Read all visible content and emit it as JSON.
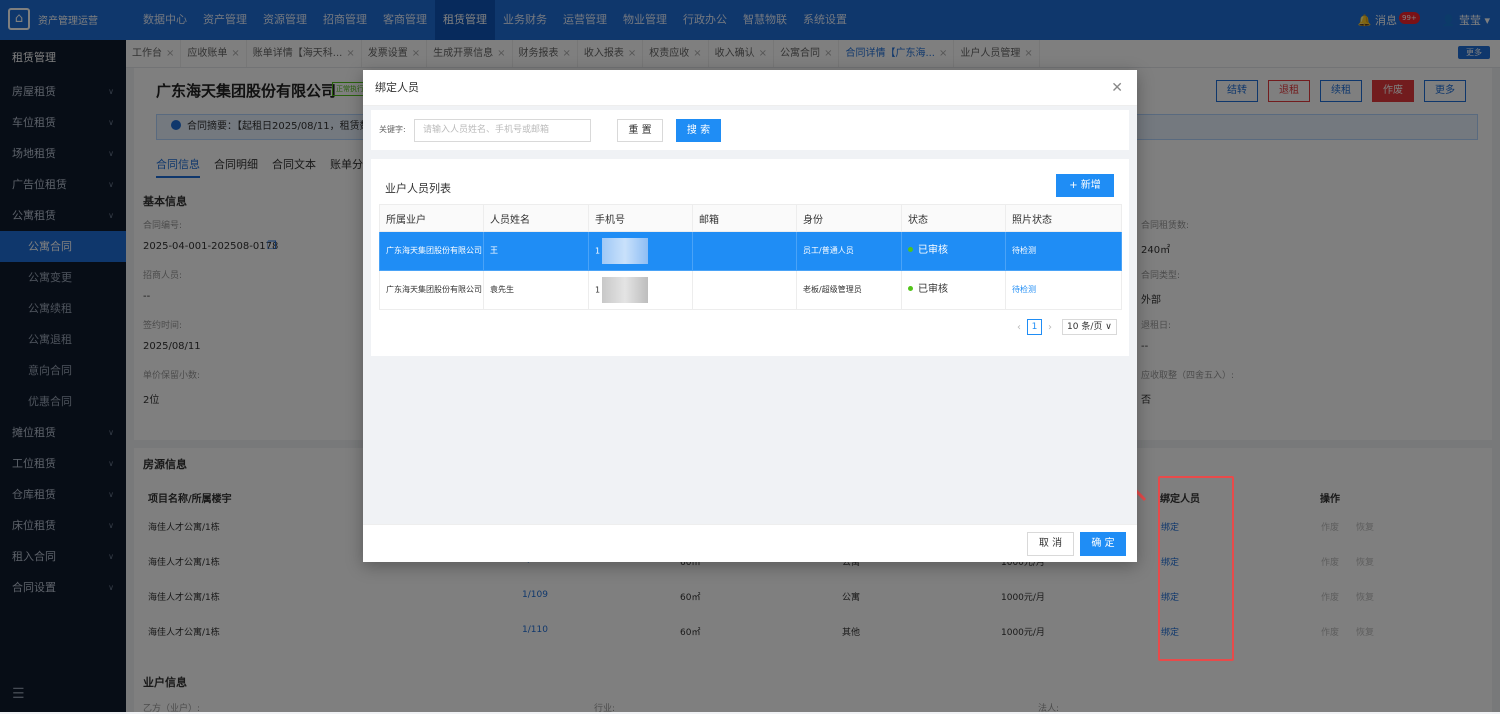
{
  "app": {
    "logo_text": "资产管理运营"
  },
  "topnav": [
    "数据中心",
    "资产管理",
    "资源管理",
    "招商管理",
    "客商管理",
    "租赁管理",
    "业务财务",
    "运营管理",
    "物业管理",
    "行政办公",
    "智慧物联",
    "系统设置"
  ],
  "topnav_active": 5,
  "topright": {
    "message": "消息",
    "message_count": "99+",
    "user": "莹莹"
  },
  "sidebar": {
    "items": [
      {
        "label": "租赁管理",
        "type": "head"
      },
      {
        "label": "房屋租赁",
        "type": "item"
      },
      {
        "label": "车位租赁",
        "type": "item"
      },
      {
        "label": "场地租赁",
        "type": "item"
      },
      {
        "label": "广告位租赁",
        "type": "item"
      },
      {
        "label": "公寓租赁",
        "type": "item"
      },
      {
        "label": "公寓合同",
        "type": "sub",
        "active": true
      },
      {
        "label": "公寓变更",
        "type": "sub"
      },
      {
        "label": "公寓续租",
        "type": "sub"
      },
      {
        "label": "公寓退租",
        "type": "sub"
      },
      {
        "label": "意向合同",
        "type": "sub"
      },
      {
        "label": "优惠合同",
        "type": "sub"
      },
      {
        "label": "摊位租赁",
        "type": "item"
      },
      {
        "label": "工位租赁",
        "type": "item"
      },
      {
        "label": "仓库租赁",
        "type": "item"
      },
      {
        "label": "床位租赁",
        "type": "item"
      },
      {
        "label": "租入合同",
        "type": "item"
      },
      {
        "label": "合同设置",
        "type": "item"
      }
    ]
  },
  "tabs": [
    "工作台",
    "应收账单",
    "账单详情【海天科...",
    "发票设置",
    "生成开票信息",
    "财务报表",
    "收入报表",
    "权责应收",
    "收入确认",
    "公寓合同",
    "合同详情【广东海...",
    "业户人员管理"
  ],
  "tabs_active": 10,
  "tab_more": "更多",
  "page": {
    "company": "广东海天集团股份有限公司",
    "status": "正常执行",
    "buttons": [
      "结转",
      "退租",
      "续租",
      "作废",
      "更多"
    ],
    "summary": "合同摘要：【起租日2025/08/11，租赁数为",
    "subtabs": [
      "合同信息",
      "合同明细",
      "合同文本",
      "账单分"
    ],
    "basic_title": "基本信息",
    "fields_left": [
      {
        "label": "合同编号:",
        "value": "2025-04-001-202508-0178"
      },
      {
        "label": "招商人员:",
        "value": "--"
      },
      {
        "label": "签约时间:",
        "value": "2025/08/11"
      },
      {
        "label": "单价保留小数:",
        "value": "2位"
      }
    ],
    "fields_right": [
      {
        "label": "合同租赁数:",
        "value": "240㎡"
      },
      {
        "label": "合同类型:",
        "value": "外部"
      },
      {
        "label": "退租日:",
        "value": "--"
      },
      {
        "label": "应收取整（四舍五入）:",
        "value": "否"
      }
    ],
    "room_title": "房源信息",
    "room_headers": {
      "project": "项目名称/所属楼宇",
      "binder": "绑定人员",
      "ops": "操作"
    },
    "room_rows": [
      {
        "project": "海佳人才公寓/1栋",
        "room": "",
        "area": "",
        "type": "",
        "price": "",
        "bind": "绑定",
        "ops": [
          "作废",
          "恢复"
        ]
      },
      {
        "project": "海佳人才公寓/1栋",
        "room": "1/108",
        "area": "60㎡",
        "type": "公寓",
        "price": "1000元/月",
        "bind": "绑定",
        "ops": [
          "作废",
          "恢复"
        ]
      },
      {
        "project": "海佳人才公寓/1栋",
        "room": "1/109",
        "area": "60㎡",
        "type": "公寓",
        "price": "1000元/月",
        "bind": "绑定",
        "ops": [
          "作废",
          "恢复"
        ]
      },
      {
        "project": "海佳人才公寓/1栋",
        "room": "1/110",
        "area": "60㎡",
        "type": "其他",
        "price": "1000元/月",
        "bind": "绑定",
        "ops": [
          "作废",
          "恢复"
        ]
      }
    ],
    "owner_title": "业户信息",
    "owner_fields": [
      "乙方（业户）:",
      "行业:",
      "法人:"
    ]
  },
  "modal": {
    "title": "绑定人员",
    "keyword_label": "关键字:",
    "keyword_placeholder": "请输入人员姓名、手机号或邮箱",
    "reset": "重 置",
    "search": "搜 索",
    "list_title": "业户人员列表",
    "add": "+ 新增",
    "headers": [
      "所属业户",
      "人员姓名",
      "手机号",
      "邮箱",
      "身份",
      "状态",
      "照片状态"
    ],
    "rows": [
      {
        "owner": "广东海天集团股份有限公司",
        "name": "王",
        "phone": "1",
        "email": "",
        "role": "员工/普通人员",
        "status": "已审核",
        "photo": "待检测",
        "selected": true
      },
      {
        "owner": "广东海天集团股份有限公司",
        "name": "袁先生",
        "phone": "1",
        "email": "",
        "role": "老板/超级管理员",
        "status": "已审核",
        "photo": "待检测",
        "selected": false
      }
    ],
    "page": "1",
    "page_size": "10 条/页",
    "cancel": "取 消",
    "ok": "确 定"
  },
  "colors": {
    "primary": "#1f6fd9",
    "button": "#1f8df5",
    "danger": "#e4393c",
    "annotation": "#e84a4a",
    "sidebar": "#0f1a2c"
  }
}
